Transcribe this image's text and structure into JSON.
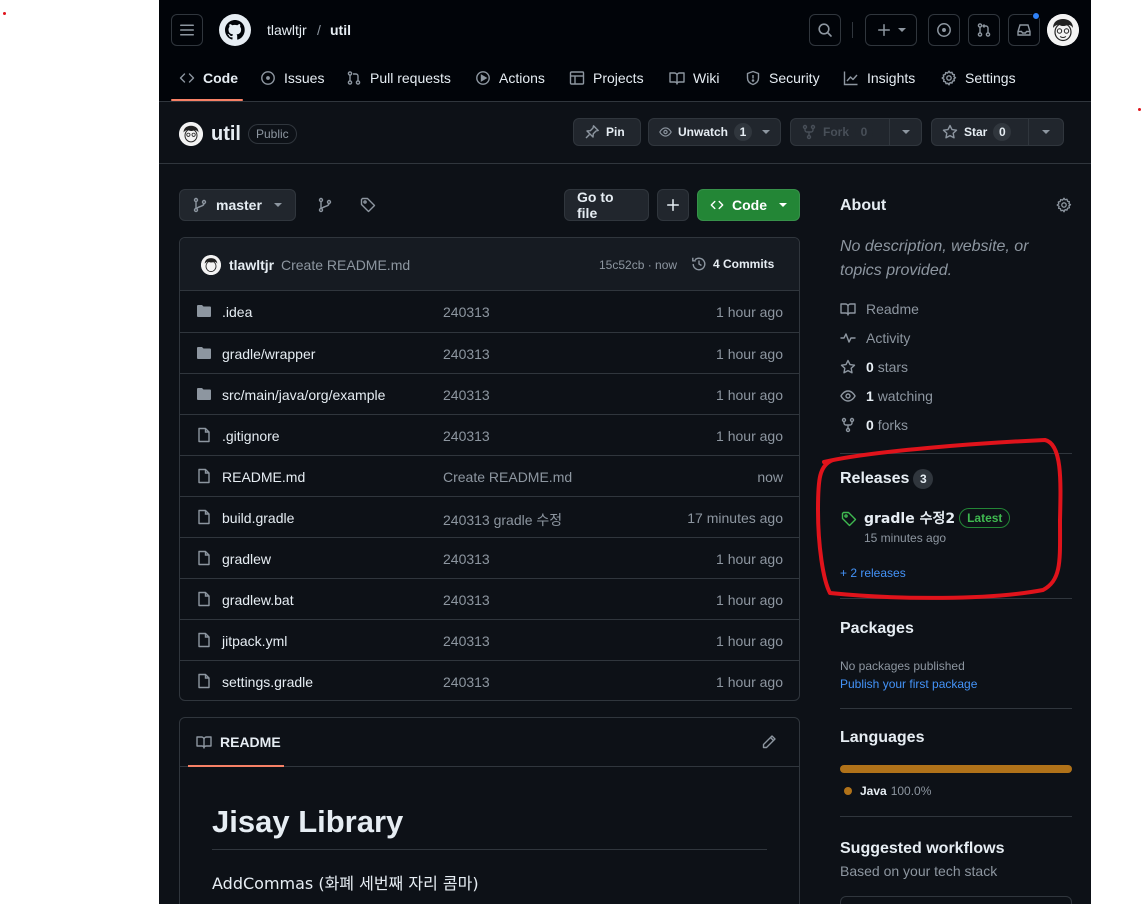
{
  "header": {
    "owner": "tlawltjr",
    "separator": "/",
    "repo": "util",
    "nav": [
      {
        "label": "Code",
        "icon": "code-icon",
        "active": true
      },
      {
        "label": "Issues",
        "icon": "issue-icon"
      },
      {
        "label": "Pull requests",
        "icon": "pull-request-icon"
      },
      {
        "label": "Actions",
        "icon": "play-icon"
      },
      {
        "label": "Projects",
        "icon": "table-icon"
      },
      {
        "label": "Wiki",
        "icon": "book-icon"
      },
      {
        "label": "Security",
        "icon": "shield-icon"
      },
      {
        "label": "Insights",
        "icon": "graph-icon"
      },
      {
        "label": "Settings",
        "icon": "gear-icon"
      }
    ]
  },
  "repo_head": {
    "name": "util",
    "visibility": "Public",
    "pin_label": "Pin",
    "unwatch_label": "Unwatch",
    "unwatch_count": "1",
    "fork_label": "Fork",
    "fork_count": "0",
    "star_label": "Star",
    "star_count": "0"
  },
  "toolbar": {
    "branch": "master",
    "go_to_file": "Go to file",
    "code_label": "Code"
  },
  "commit": {
    "author": "tlawltjr",
    "message": "Create README.md",
    "sha_time": "15c52cb · now",
    "commits_label": "4 Commits"
  },
  "files": [
    {
      "name": ".idea",
      "type": "folder",
      "message": "240313",
      "age": "1 hour ago"
    },
    {
      "name": "gradle/wrapper",
      "type": "folder",
      "message": "240313",
      "age": "1 hour ago"
    },
    {
      "name": "src/main/java/org/example",
      "type": "folder",
      "message": "240313",
      "age": "1 hour ago"
    },
    {
      "name": ".gitignore",
      "type": "file",
      "message": "240313",
      "age": "1 hour ago"
    },
    {
      "name": "README.md",
      "type": "file",
      "message": "Create README.md",
      "age": "now"
    },
    {
      "name": "build.gradle",
      "type": "file",
      "message": "240313 gradle 수정",
      "age": "17 minutes ago"
    },
    {
      "name": "gradlew",
      "type": "file",
      "message": "240313",
      "age": "1 hour ago"
    },
    {
      "name": "gradlew.bat",
      "type": "file",
      "message": "240313",
      "age": "1 hour ago"
    },
    {
      "name": "jitpack.yml",
      "type": "file",
      "message": "240313",
      "age": "1 hour ago"
    },
    {
      "name": "settings.gradle",
      "type": "file",
      "message": "240313",
      "age": "1 hour ago"
    }
  ],
  "readme": {
    "tab_label": "README",
    "title": "Jisay Library",
    "paragraph": "AddCommas (화폐 세번째 자리 콤마)"
  },
  "about": {
    "title": "About",
    "description": "No description, website, or topics provided.",
    "readme": "Readme",
    "activity": "Activity",
    "stars_count": "0",
    "stars_label": "stars",
    "watching_count": "1",
    "watching_label": "watching",
    "forks_count": "0",
    "forks_label": "forks"
  },
  "releases": {
    "title": "Releases",
    "count": "3",
    "latest_name": "gradle 수정2",
    "latest_badge": "Latest",
    "latest_time": "15 minutes ago",
    "more_link": "+ 2 releases"
  },
  "packages": {
    "title": "Packages",
    "none": "No packages published",
    "publish_link": "Publish your first package"
  },
  "languages": {
    "title": "Languages",
    "items": [
      {
        "name": "Java",
        "percent": "100.0%",
        "color": "#b07219"
      }
    ]
  },
  "workflows": {
    "title": "Suggested workflows",
    "subtitle": "Based on your tech stack"
  },
  "colors": {
    "annotation": "#e0131b",
    "accent_green": "#238636",
    "link": "#4493f8",
    "tab_underline": "#f78166"
  }
}
